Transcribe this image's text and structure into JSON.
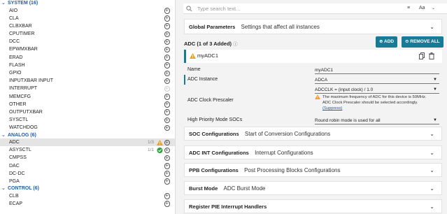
{
  "sidebar": {
    "categories": [
      {
        "title": "SYSTEM (16)",
        "items": [
          {
            "label": "AIO"
          },
          {
            "label": "CLA"
          },
          {
            "label": "CLBXBAR"
          },
          {
            "label": "CPUTIMER"
          },
          {
            "label": "DCC"
          },
          {
            "label": "EPWMXBAR"
          },
          {
            "label": "ERAD"
          },
          {
            "label": "FLASH"
          },
          {
            "label": "GPIO"
          },
          {
            "label": "INPUTXBAR INPUT"
          },
          {
            "label": "INTERRUPT",
            "disabled": true
          },
          {
            "label": "MEMCFG"
          },
          {
            "label": "OTHER"
          },
          {
            "label": "OUTPUTXBAR"
          },
          {
            "label": "SYSCTL"
          },
          {
            "label": "WATCHDOG"
          }
        ]
      },
      {
        "title": "ANALOG (6)",
        "items": [
          {
            "label": "ADC",
            "count": "1/3",
            "status": "warning",
            "selected": true
          },
          {
            "label": "ASYSCTL",
            "count": "1/1",
            "status": "ok"
          },
          {
            "label": "CMPSS"
          },
          {
            "label": "DAC"
          },
          {
            "label": "DC-DC"
          },
          {
            "label": "PGA"
          }
        ]
      },
      {
        "title": "CONTROL (6)",
        "items": [
          {
            "label": "CLB"
          },
          {
            "label": "ECAP"
          }
        ]
      }
    ]
  },
  "search": {
    "placeholder": "Type search text...",
    "case_label": "Aa"
  },
  "global": {
    "title": "Global Parameters",
    "desc": "Settings that affect all instances"
  },
  "adc": {
    "header": "ADC (1 of 3 Added)",
    "add_label": "ADD",
    "remove_label": "REMOVE ALL",
    "instance_name": "myADC1"
  },
  "fields": {
    "name_label": "Name",
    "name_value": "myADC1",
    "instance_label": "ADC Instance",
    "instance_value": "ADCA",
    "prescaler_label": "ADC Clock Prescaler",
    "prescaler_value": "ADCCLK = (input clock) / 1.0",
    "warning_line1": "The maximum frequency of ADC for this device is 50MHz.",
    "warning_line2": "ADC Clock Prescaler should be selected accordingly.",
    "suppress_label": "(Suppress)",
    "soc_label": "High Priority Mode SOCs",
    "soc_value": "Round robin mode is used for all"
  },
  "sections": [
    {
      "title": "SOC Configurations",
      "desc": "Start of Conversion Configurations"
    },
    {
      "title": "ADC INT Configurations",
      "desc": "Interrupt Configurations"
    },
    {
      "title": "PPB Configurations",
      "desc": "Post Processing Blocks Configurations"
    },
    {
      "title": "Burst Mode",
      "desc": "ADC Burst Mode"
    },
    {
      "title": "Register PIE Interrupt Handlers",
      "desc": ""
    }
  ],
  "colors": {
    "accent": "#177a96",
    "link": "#1c5fa8",
    "warning": "#f0a020",
    "ok": "#2e9e3e"
  }
}
